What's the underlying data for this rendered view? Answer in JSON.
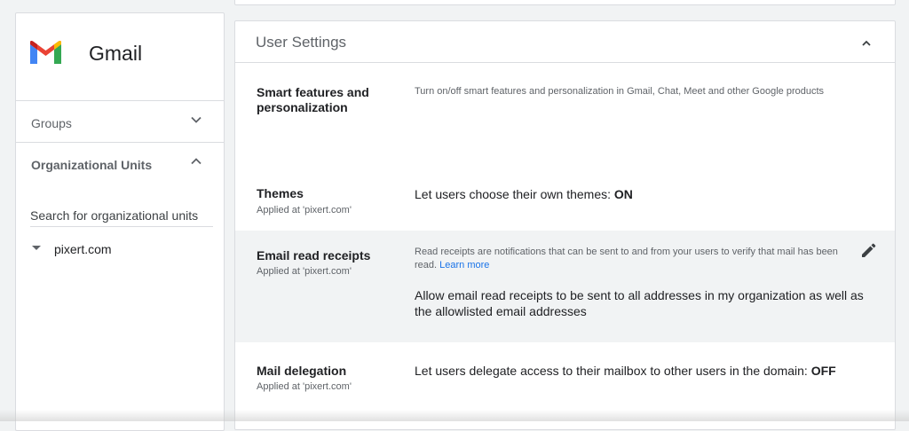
{
  "app": {
    "name": "Gmail"
  },
  "nav": {
    "groups_label": "Groups",
    "org_units_label": "Organizational Units",
    "search_placeholder": "Search for organizational units",
    "tree": [
      {
        "label": "pixert.com",
        "expanded": true
      }
    ]
  },
  "settings": {
    "title": "User Settings",
    "rows": [
      {
        "name": "Smart features and personalization",
        "description": "Turn on/off smart features and personalization in Gmail, Chat, Meet and other Google products"
      },
      {
        "name": "Themes",
        "applied": "Applied at 'pixert.com'",
        "value_text": "Let users choose their own themes: ",
        "value_state": "ON"
      },
      {
        "name": "Email read receipts",
        "applied": "Applied at 'pixert.com'",
        "description": "Read receipts are notifications that can be sent to and from your users to verify that mail has been read.",
        "learn_more": "Learn more",
        "value_text": "Allow email read receipts to be sent to all addresses in my organization as well as the allowlisted email addresses",
        "highlighted": true
      },
      {
        "name": "Mail delegation",
        "applied": "Applied at 'pixert.com'",
        "value_text": "Let users delegate access to their mailbox to other users in the domain: ",
        "value_state": "OFF"
      }
    ]
  },
  "colors": {
    "gmail_red": "#EA4335",
    "gmail_blue": "#4285F4",
    "gmail_green": "#34A853",
    "gmail_yellow": "#FBBC04",
    "link": "#1a73e8",
    "highlight_row": "#f1f3f4"
  },
  "icons": {
    "logo": "gmail-logo",
    "groups_toggle": "chevron-down-icon",
    "org_units_toggle": "chevron-up-icon",
    "tree_caret": "caret-down-icon",
    "card_collapse": "chevron-up-icon",
    "edit": "pencil-icon"
  }
}
